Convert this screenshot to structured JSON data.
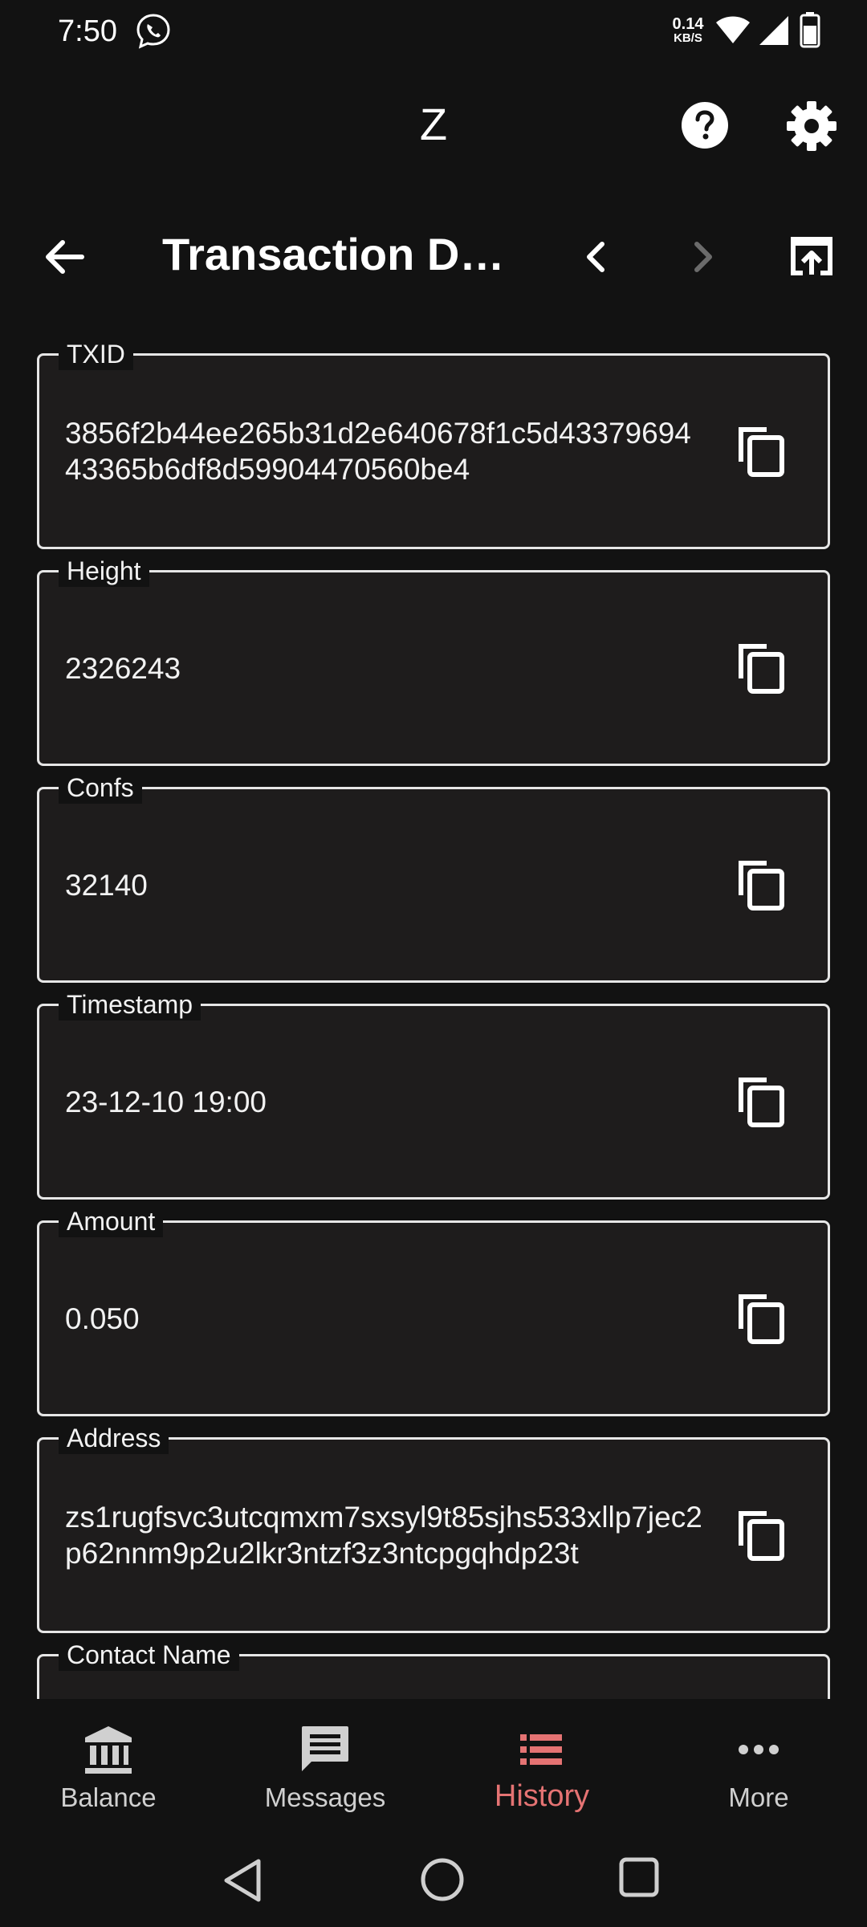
{
  "status_bar": {
    "time": "7:50",
    "net_speed_value": "0.14",
    "net_speed_unit": "KB/S"
  },
  "app_header": {
    "title": "Z"
  },
  "sub_header": {
    "title": "Transaction De..."
  },
  "fields": [
    {
      "label": "TXID",
      "value": "3856f2b44ee265b31d2e640678f1c5d4337969443365b6df8d59904470560be4"
    },
    {
      "label": "Height",
      "value": "2326243"
    },
    {
      "label": "Confs",
      "value": "32140"
    },
    {
      "label": "Timestamp",
      "value": "23-12-10 19:00"
    },
    {
      "label": "Amount",
      "value": "0.050"
    },
    {
      "label": "Address",
      "value": "zs1rugfsvc3utcqmxm7sxsyl9t85sjhs533xllp7jec2p62nnm9p2u2lkr3ntzf3z3ntcpgqhdp23t"
    },
    {
      "label": "Contact Name",
      "value": ""
    }
  ],
  "bottom_nav": {
    "items": [
      {
        "label": "Balance",
        "icon": "bank-icon",
        "active": false
      },
      {
        "label": "Messages",
        "icon": "message-icon",
        "active": false
      },
      {
        "label": "History",
        "icon": "list-icon",
        "active": true
      },
      {
        "label": "More",
        "icon": "more-horizontal-icon",
        "active": false
      }
    ]
  },
  "colors": {
    "background": "#121212",
    "field_background": "#1e1c1c",
    "field_border": "#e6e6e6",
    "active_nav": "#e57373",
    "text": "#ffffff"
  }
}
